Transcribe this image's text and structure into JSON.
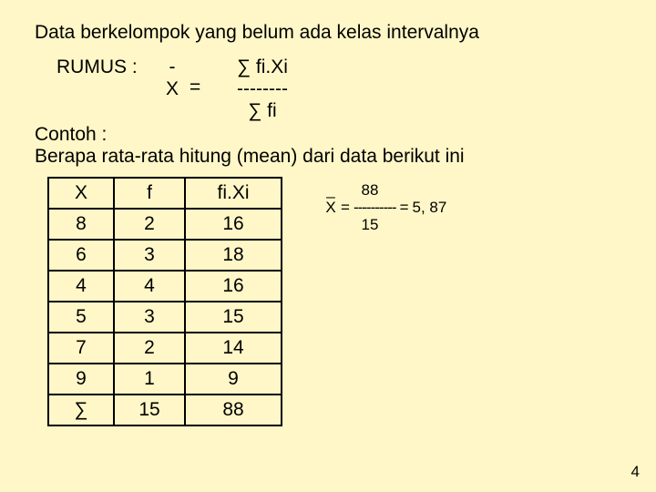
{
  "title": "Data berkelompok yang belum ada kelas intervalnya",
  "rumus_label": "RUMUS :",
  "minus": "-",
  "xbar_x": "X",
  "equals": "=",
  "frac_top": "∑ fi.Xi",
  "frac_mid": "--------",
  "frac_bot": "∑ fi",
  "contoh_label": "Contoh :",
  "contoh_text": "Berapa rata-rata hitung (mean) dari data berikut ini",
  "table": {
    "headers": [
      "X",
      "f",
      "fi.Xi"
    ],
    "rows": [
      [
        "8",
        "2",
        "16"
      ],
      [
        "6",
        "3",
        "18"
      ],
      [
        "4",
        "4",
        "16"
      ],
      [
        "5",
        "3",
        "15"
      ],
      [
        "7",
        "2",
        "14"
      ],
      [
        "9",
        "1",
        "9"
      ]
    ],
    "sum_label": "∑",
    "sum_f": "15",
    "sum_fx": "88"
  },
  "calc": {
    "bar": "_",
    "x": "X",
    "eq": "=",
    "num": "88",
    "dash": "----------",
    "den": "15",
    "eq2": "=",
    "result": "5, 87"
  },
  "page": "4"
}
